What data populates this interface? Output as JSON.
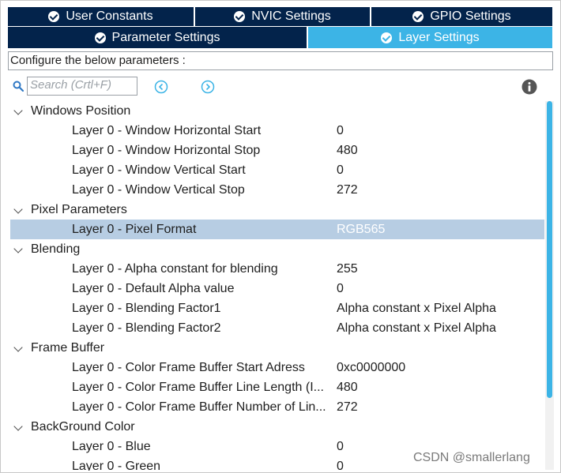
{
  "tabs": {
    "row1": [
      {
        "label": "User Constants",
        "active": false
      },
      {
        "label": "NVIC Settings",
        "active": false
      },
      {
        "label": "GPIO Settings",
        "active": false
      }
    ],
    "row2": [
      {
        "label": "Parameter Settings",
        "active": false
      },
      {
        "label": "Layer Settings",
        "active": true
      }
    ]
  },
  "description": "Configure the below parameters :",
  "search": {
    "placeholder": "Search (Crtl+F)"
  },
  "tree": {
    "groups": [
      {
        "label": "Windows Position",
        "params": [
          {
            "name": "Layer 0 - Window Horizontal Start",
            "value": "0"
          },
          {
            "name": "Layer 0 - Window Horizontal Stop",
            "value": "480"
          },
          {
            "name": "Layer 0 - Window Vertical Start",
            "value": "0"
          },
          {
            "name": "Layer 0 - Window Vertical Stop",
            "value": "272"
          }
        ]
      },
      {
        "label": "Pixel Parameters",
        "params": [
          {
            "name": "Layer 0 - Pixel Format",
            "value": "RGB565",
            "selected": true
          }
        ]
      },
      {
        "label": "Blending",
        "params": [
          {
            "name": "Layer 0 - Alpha constant for blending",
            "value": "255"
          },
          {
            "name": "Layer 0 - Default Alpha value",
            "value": "0"
          },
          {
            "name": "Layer 0 - Blending Factor1",
            "value": "Alpha constant x Pixel Alpha"
          },
          {
            "name": "Layer 0 - Blending Factor2",
            "value": "Alpha constant x Pixel Alpha"
          }
        ]
      },
      {
        "label": "Frame Buffer",
        "params": [
          {
            "name": "Layer 0 - Color Frame Buffer Start Adress",
            "value": "0xc0000000"
          },
          {
            "name": "Layer 0 - Color Frame Buffer Line Length (I...",
            "value": "480"
          },
          {
            "name": "Layer 0 - Color Frame Buffer Number of Lin...",
            "value": "272"
          }
        ]
      },
      {
        "label": "BackGround Color",
        "params": [
          {
            "name": "Layer 0 - Blue",
            "value": "0"
          },
          {
            "name": "Layer 0 - Green",
            "value": "0"
          }
        ]
      }
    ]
  },
  "watermark": "CSDN @smallerlang",
  "colors": {
    "tab_dark": "#03234b",
    "tab_active": "#3cb4e6",
    "selection": "#b7cde3"
  }
}
